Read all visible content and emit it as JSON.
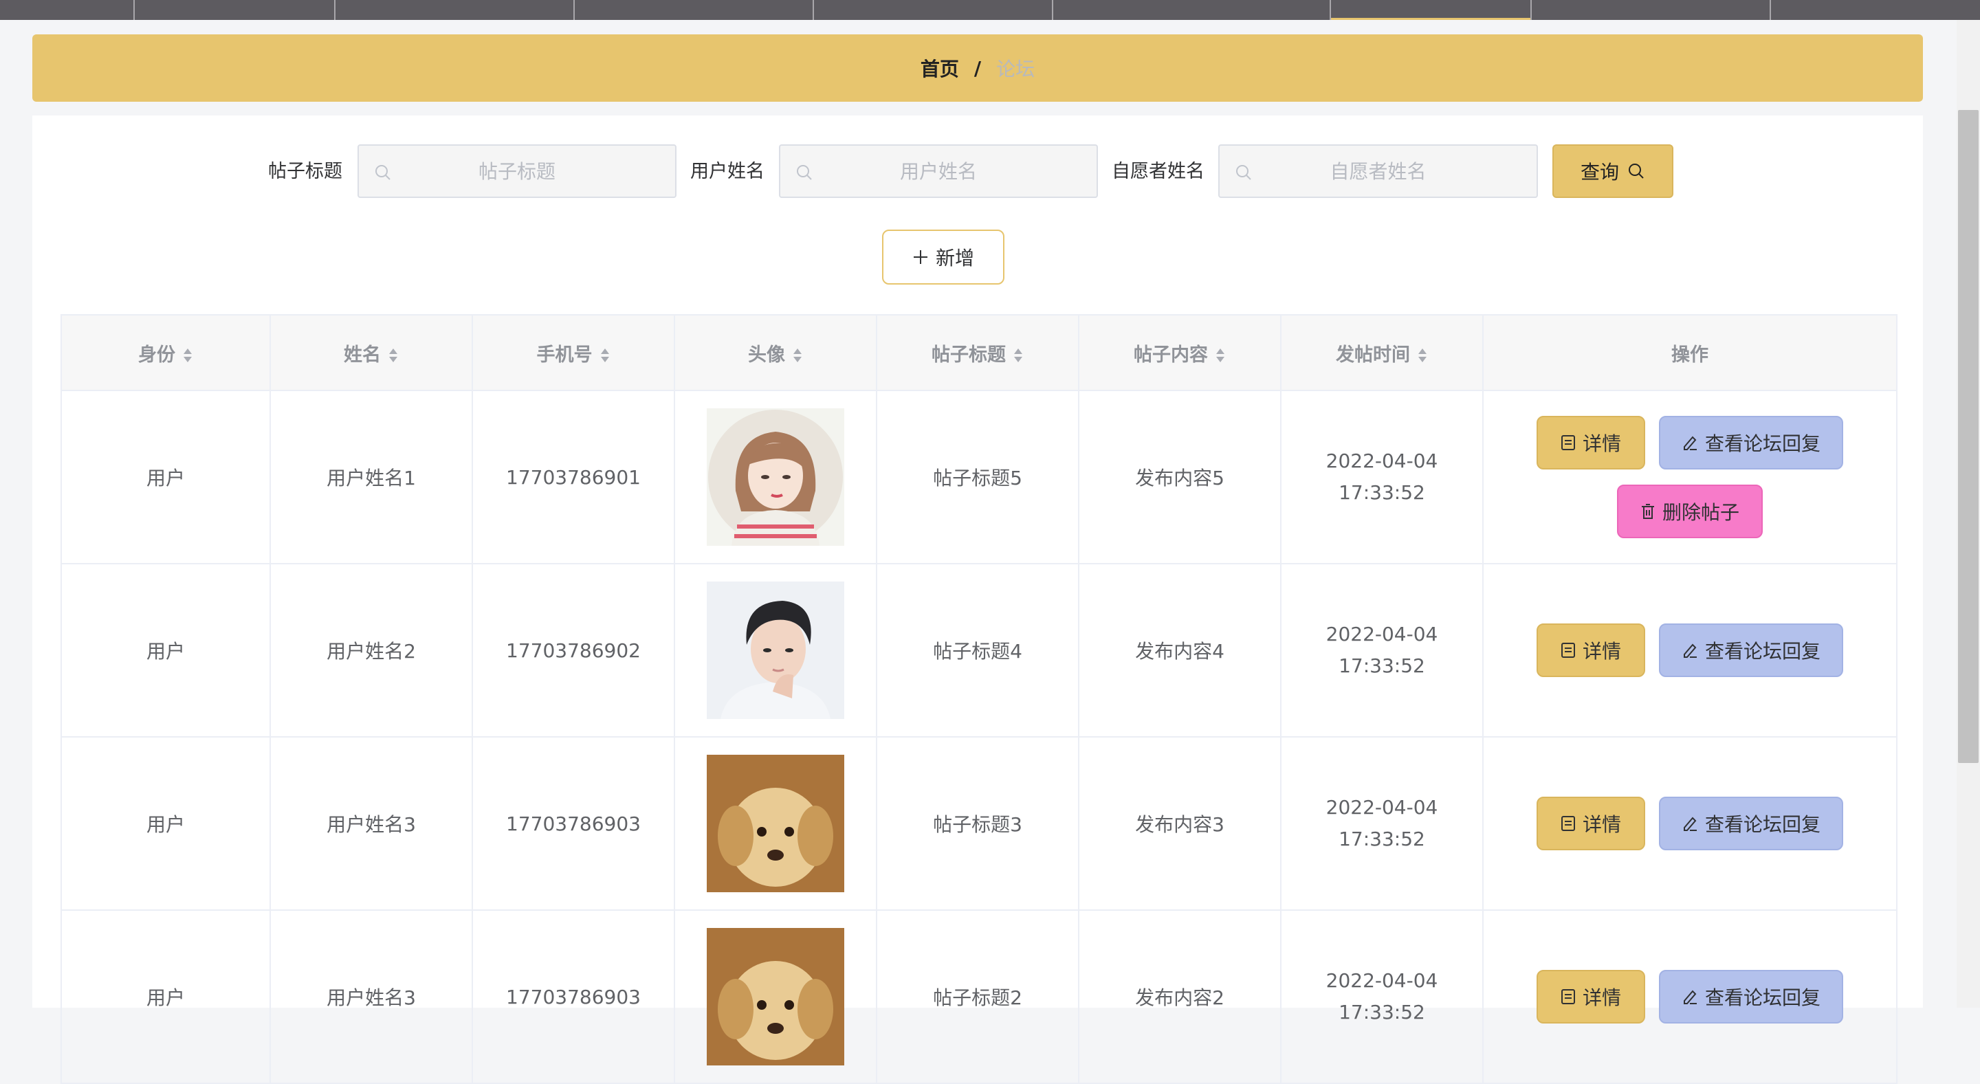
{
  "breadcrumb": {
    "home": "首页",
    "separator": "/",
    "current": "论坛"
  },
  "search": {
    "fields": [
      {
        "label": "帖子标题",
        "placeholder": "帖子标题"
      },
      {
        "label": "用户姓名",
        "placeholder": "用户姓名"
      },
      {
        "label": "自愿者姓名",
        "placeholder": "自愿者姓名"
      }
    ],
    "query_label": "查询"
  },
  "toolbar": {
    "add_label": "新增"
  },
  "table": {
    "columns": [
      "身份",
      "姓名",
      "手机号",
      "头像",
      "帖子标题",
      "帖子内容",
      "发帖时间",
      "操作"
    ],
    "rows": [
      {
        "role": "用户",
        "name": "用户姓名1",
        "phone": "17703786901",
        "avatar": "cartoon-girl-avatar",
        "title": "帖子标题5",
        "content": "发布内容5",
        "time": "2022-04-04 17:33:52"
      },
      {
        "role": "用户",
        "name": "用户姓名2",
        "phone": "17703786902",
        "avatar": "young-man-avatar",
        "title": "帖子标题4",
        "content": "发布内容4",
        "time": "2022-04-04 17:33:52"
      },
      {
        "role": "用户",
        "name": "用户姓名3",
        "phone": "17703786903",
        "avatar": "puppy-avatar",
        "title": "帖子标题3",
        "content": "发布内容3",
        "time": "2022-04-04 17:33:52"
      },
      {
        "role": "用户",
        "name": "用户姓名3",
        "phone": "17703786903",
        "avatar": "puppy-avatar",
        "title": "帖子标题2",
        "content": "发布内容2",
        "time": "2022-04-04 17:33:52"
      }
    ],
    "actions": {
      "detail": "详情",
      "reply": "查看论坛回复",
      "delete": "删除帖子"
    }
  },
  "colors": {
    "accent": "#e7c56e",
    "reply": "#b3c1ec",
    "delete": "#f77bc9",
    "nav": "#5d5b60"
  }
}
